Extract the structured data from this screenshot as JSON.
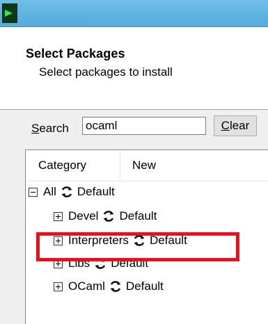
{
  "header": {
    "title": "Select Packages",
    "subtitle": "Select packages to install"
  },
  "search": {
    "label_mnemonic": "S",
    "label_rest": "earch",
    "value": "ocaml"
  },
  "clear_button": {
    "mnemonic": "C",
    "rest": "lear"
  },
  "columns": {
    "category": "Category",
    "new": "New"
  },
  "tree": {
    "all": {
      "name": "All",
      "action": "Default",
      "expander": "minus"
    },
    "devel": {
      "name": "Devel",
      "action": "Default",
      "expander": "plus"
    },
    "interpreters": {
      "name": "Interpreters",
      "action": "Default",
      "expander": "plus"
    },
    "libs": {
      "name": "Libs",
      "action": "Default",
      "expander": "plus"
    },
    "ocaml": {
      "name": "OCaml",
      "action": "Default",
      "expander": "plus"
    }
  },
  "icons": {
    "app": "terminal-icon",
    "cycle": "cycle-arrows-icon"
  },
  "colors": {
    "titlebar": "#5cb2df",
    "highlight": "#e0141e"
  }
}
